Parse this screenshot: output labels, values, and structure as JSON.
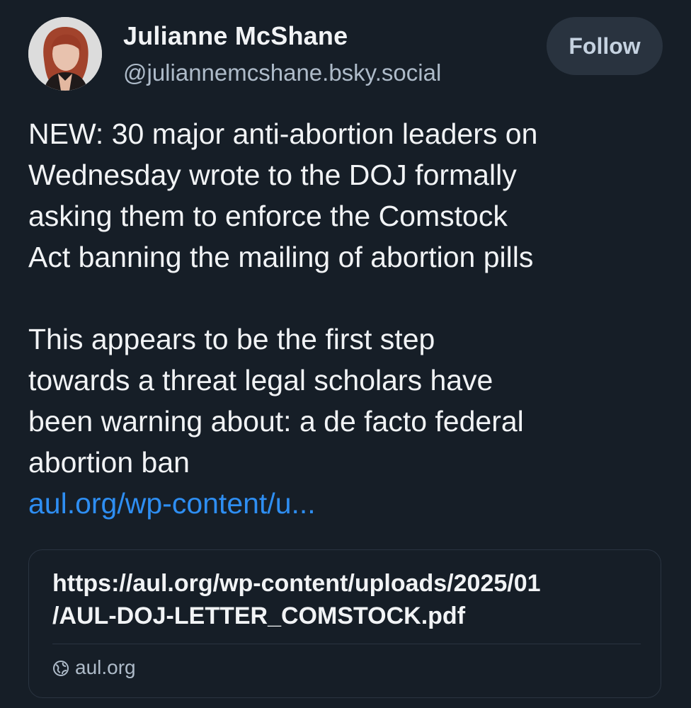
{
  "author": {
    "display_name": "Julianne McShane",
    "handle": "@juliannemcshane.bsky.social",
    "avatar_icon": "profile-photo"
  },
  "follow_button": {
    "label": "Follow"
  },
  "post": {
    "paragraph1": [
      "NEW: 30 major anti-abortion leaders on",
      "Wednesday wrote to the DOJ formally",
      "asking them to enforce the Comstock",
      "Act banning the mailing of abortion pills"
    ],
    "paragraph2": [
      "This appears to be the first step",
      "towards a threat legal scholars have",
      "been warning about: a de facto federal",
      "abortion ban"
    ],
    "link_text": "aul.org/wp-content/u..."
  },
  "embed": {
    "url_lines": [
      "https://aul.org/wp-content/uploads/2025/01",
      "/AUL-DOJ-LETTER_COMSTOCK.pdf"
    ],
    "domain": "aul.org",
    "domain_icon": "globe-icon"
  },
  "colors": {
    "background": "#161e27",
    "link": "#2e8ef2",
    "muted_text": "#aebbc9",
    "button_bg": "#29333f"
  }
}
